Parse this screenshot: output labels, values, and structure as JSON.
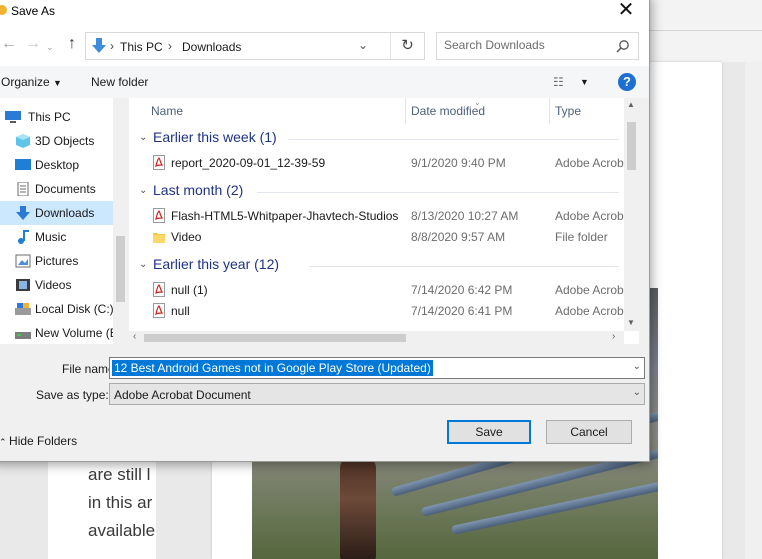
{
  "window": {
    "title": "Save As"
  },
  "address": {
    "crumbs": [
      "This PC",
      "Downloads"
    ]
  },
  "search": {
    "placeholder": "Search Downloads"
  },
  "toolbar": {
    "organize": "Organize",
    "new_folder": "New folder"
  },
  "nav": {
    "items": [
      {
        "label": "This PC",
        "icon": "computer-icon"
      },
      {
        "label": "3D Objects",
        "icon": "cube-icon"
      },
      {
        "label": "Desktop",
        "icon": "desktop-icon"
      },
      {
        "label": "Documents",
        "icon": "document-icon"
      },
      {
        "label": "Downloads",
        "icon": "download-icon",
        "selected": true
      },
      {
        "label": "Music",
        "icon": "music-icon"
      },
      {
        "label": "Pictures",
        "icon": "pictures-icon"
      },
      {
        "label": "Videos",
        "icon": "video-icon"
      },
      {
        "label": "Local Disk (C:)",
        "icon": "disk-icon"
      },
      {
        "label": "New Volume (E:)",
        "icon": "drive-icon"
      }
    ]
  },
  "columns": {
    "name": "Name",
    "date": "Date modified",
    "type": "Type"
  },
  "groups": [
    {
      "label": "Earlier this week (1)",
      "files": [
        {
          "name": "report_2020-09-01_12-39-59",
          "date": "9/1/2020 9:40 PM",
          "type": "Adobe Acrobat Document",
          "icon": "pdf-icon"
        }
      ]
    },
    {
      "label": "Last month (2)",
      "files": [
        {
          "name": "Flash-HTML5-Whitpaper-Jhavtech-Studios",
          "date": "8/13/2020 10:27 AM",
          "type": "Adobe Acrobat Document",
          "icon": "pdf-icon"
        },
        {
          "name": "Video",
          "date": "8/8/2020 9:57 AM",
          "type": "File folder",
          "icon": "folder-icon"
        }
      ]
    },
    {
      "label": "Earlier this year (12)",
      "files": [
        {
          "name": "null (1)",
          "date": "7/14/2020 6:42 PM",
          "type": "Adobe Acrobat Document",
          "icon": "pdf-icon"
        },
        {
          "name": "null",
          "date": "7/14/2020 6:41 PM",
          "type": "Adobe Acrobat Document",
          "icon": "pdf-icon"
        }
      ]
    }
  ],
  "form": {
    "file_name_label": "File name:",
    "file_name_value": "12 Best Android Games not in Google Play Store (Updated)",
    "save_type_label": "Save as type:",
    "save_type_value": "Adobe Acrobat Document"
  },
  "footer": {
    "hide_folders": "Hide Folders",
    "save": "Save",
    "cancel": "Cancel"
  },
  "background": {
    "text_lines": [
      "are still l",
      "in this ar",
      "available"
    ]
  },
  "colors": {
    "accent": "#0078d7",
    "selected_nav": "#cce8ff",
    "group_heading": "#1e3287",
    "pdf_red": "#d0201c",
    "folder_yellow": "#f3c843"
  }
}
